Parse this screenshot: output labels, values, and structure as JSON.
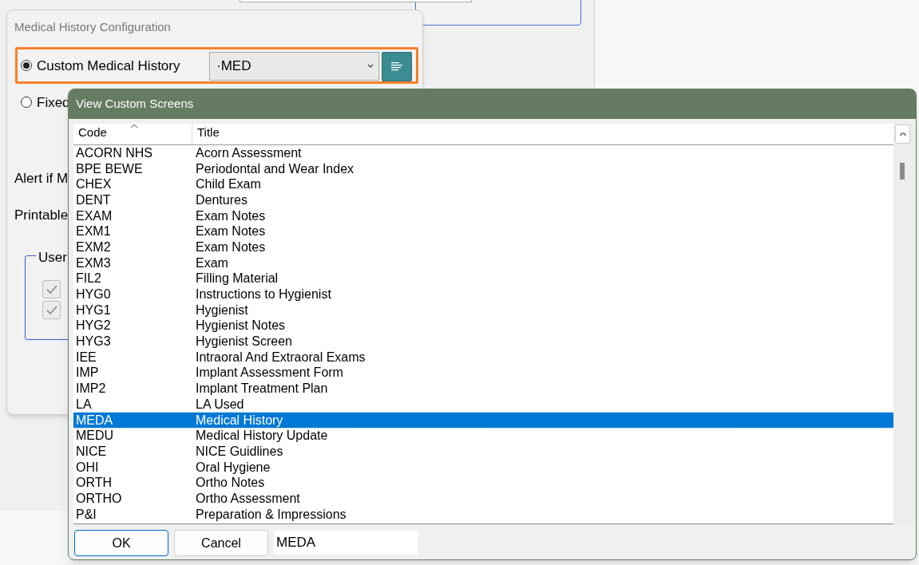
{
  "config_dialog": {
    "title": "Medical History Configuration",
    "options": [
      {
        "label": "Custom Medical History",
        "selected": true,
        "highlighted": true,
        "dropdown_value": "·MED"
      },
      {
        "label": "Fixed",
        "selected": false,
        "highlighted": false
      }
    ],
    "labels": [
      "Alert if M",
      "Printable"
    ],
    "group": {
      "title": "User",
      "checkboxes": [
        {
          "checked": true,
          "disabled": true
        },
        {
          "checked": true,
          "disabled": true
        }
      ]
    }
  },
  "custom_screens_dialog": {
    "title": "View Custom Screens",
    "columns": [
      "Code",
      "Title"
    ],
    "rows": [
      {
        "code": "ACORN NHS",
        "title": "Acorn Assessment",
        "selected": false
      },
      {
        "code": "BPE BEWE",
        "title": "Periodontal and Wear Index",
        "selected": false
      },
      {
        "code": "CHEX",
        "title": "Child Exam",
        "selected": false
      },
      {
        "code": "DENT",
        "title": "Dentures",
        "selected": false
      },
      {
        "code": "EXAM",
        "title": "Exam Notes",
        "selected": false
      },
      {
        "code": "EXM1",
        "title": "Exam Notes",
        "selected": false
      },
      {
        "code": "EXM2",
        "title": "Exam Notes",
        "selected": false
      },
      {
        "code": "EXM3",
        "title": "Exam",
        "selected": false
      },
      {
        "code": "FIL2",
        "title": "Filling Material",
        "selected": false
      },
      {
        "code": "HYG0",
        "title": "Instructions to Hygienist",
        "selected": false
      },
      {
        "code": "HYG1",
        "title": "Hygienist",
        "selected": false
      },
      {
        "code": "HYG2",
        "title": "Hygienist Notes",
        "selected": false
      },
      {
        "code": "HYG3",
        "title": "Hygienist Screen",
        "selected": false
      },
      {
        "code": "IEE",
        "title": "Intraoral And Extraoral Exams",
        "selected": false
      },
      {
        "code": "IMP",
        "title": "Implant Assessment Form",
        "selected": false
      },
      {
        "code": "IMP2",
        "title": "Implant Treatment Plan",
        "selected": false
      },
      {
        "code": "LA",
        "title": "LA Used",
        "selected": false
      },
      {
        "code": "MEDA",
        "title": "Medical History",
        "selected": true
      },
      {
        "code": "MEDU",
        "title": "Medical History Update",
        "selected": false
      },
      {
        "code": "NICE",
        "title": "NICE Guidlines",
        "selected": false
      },
      {
        "code": "OHI",
        "title": "Oral Hygiene",
        "selected": false
      },
      {
        "code": "ORTH",
        "title": "Ortho Notes",
        "selected": false
      },
      {
        "code": "ORTHO",
        "title": "Ortho Assessment",
        "selected": false
      },
      {
        "code": "P&I",
        "title": "Preparation & Impressions",
        "selected": false
      }
    ],
    "buttons": [
      {
        "label": "OK",
        "default": true
      },
      {
        "label": "Cancel",
        "default": false
      }
    ],
    "code_field": {
      "value": "MEDA"
    }
  }
}
